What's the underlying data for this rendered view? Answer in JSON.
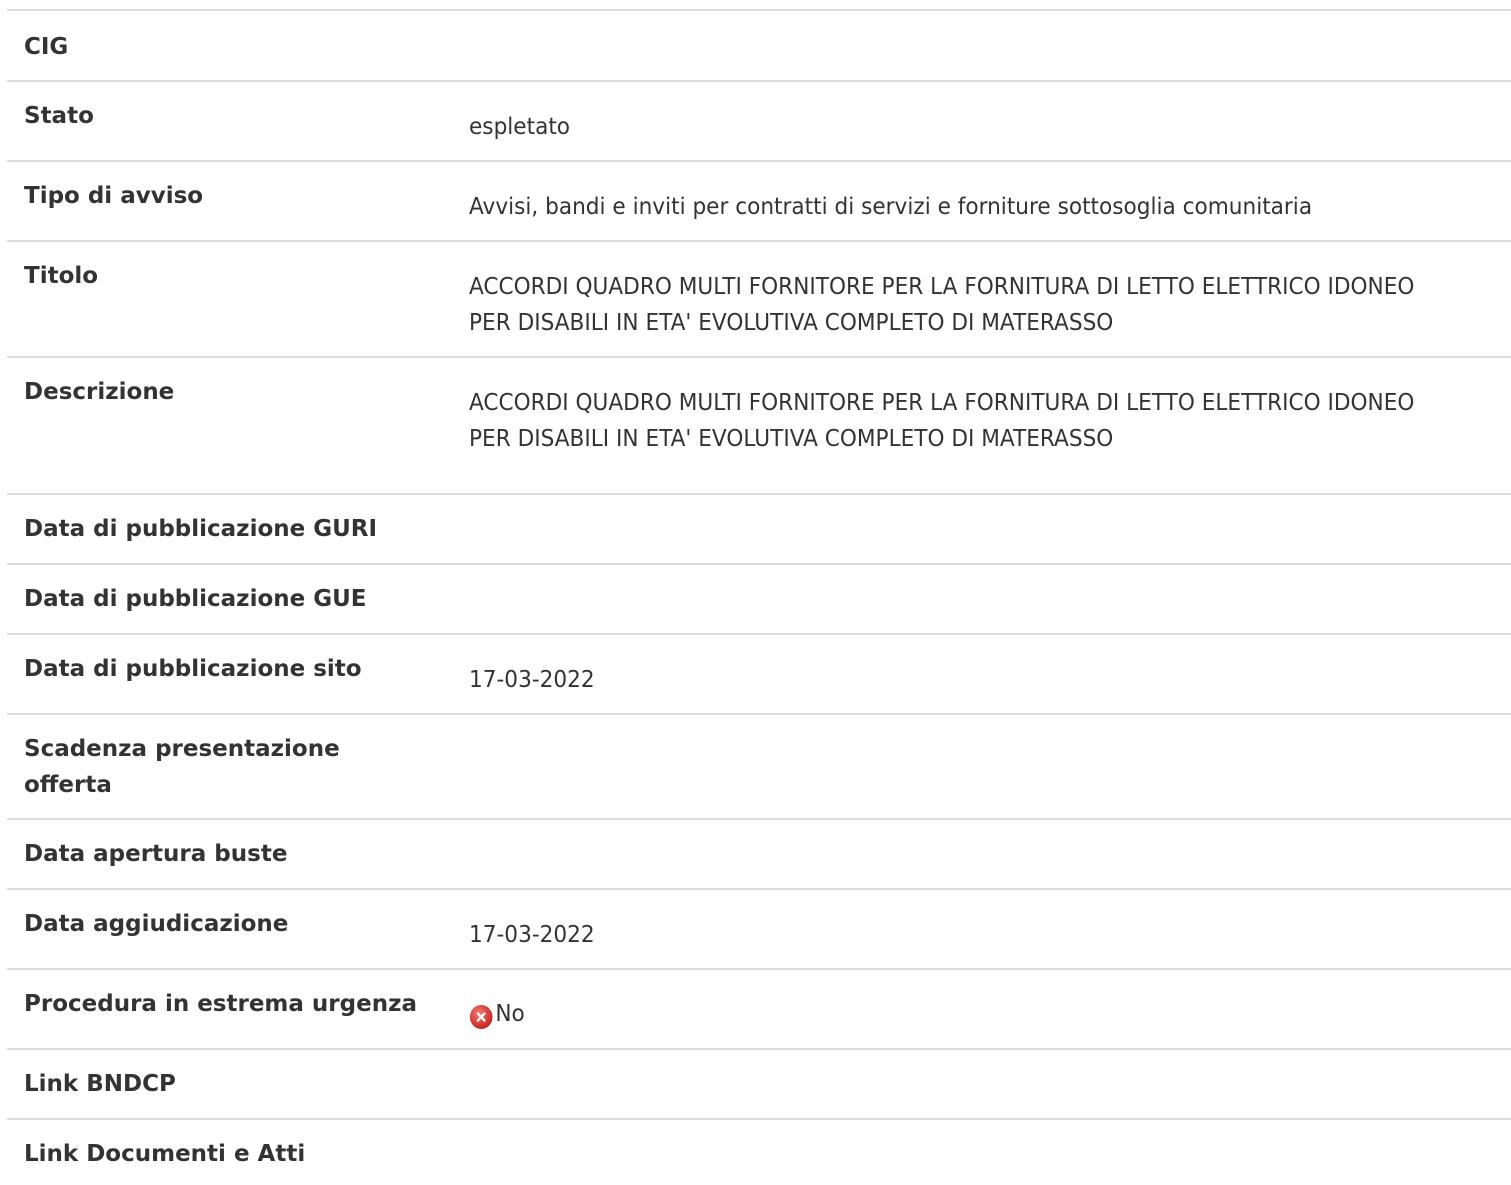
{
  "rows": [
    {
      "label": "CIG",
      "value": ""
    },
    {
      "label": "Stato",
      "value": "espletato"
    },
    {
      "label": "Tipo di avviso",
      "value": "Avvisi, bandi e inviti per contratti di servizi e forniture sottosoglia comunitaria"
    },
    {
      "label": "Titolo",
      "value": "ACCORDI QUADRO MULTI FORNITORE PER LA FORNITURA DI LETTO ELETTRICO IDONEO PER DISABILI IN ETA' EVOLUTIVA COMPLETO DI MATERASSO"
    },
    {
      "label": "Descrizione",
      "value": "ACCORDI QUADRO MULTI FORNITORE PER LA FORNITURA DI LETTO ELETTRICO IDONEO PER DISABILI IN ETA' EVOLUTIVA COMPLETO DI MATERASSO"
    },
    {
      "label": "Data di pubblicazione GURI",
      "value": ""
    },
    {
      "label": "Data di pubblicazione GUE",
      "value": ""
    },
    {
      "label": "Data di pubblicazione sito",
      "value": "17-03-2022"
    },
    {
      "label": "Scadenza presentazione offerta",
      "value": ""
    },
    {
      "label": "Data apertura buste",
      "value": ""
    },
    {
      "label": "Data aggiudicazione",
      "value": "17-03-2022"
    },
    {
      "label": "Procedura in estrema urgenza",
      "value": "No",
      "icon": "red-x-circle-icon"
    },
    {
      "label": "Link BNDCP",
      "value": ""
    },
    {
      "label": "Link Documenti e Atti",
      "value": ""
    }
  ],
  "colors": {
    "text": "#333333",
    "divider": "#dddddd",
    "no_icon": "#d9302a"
  }
}
